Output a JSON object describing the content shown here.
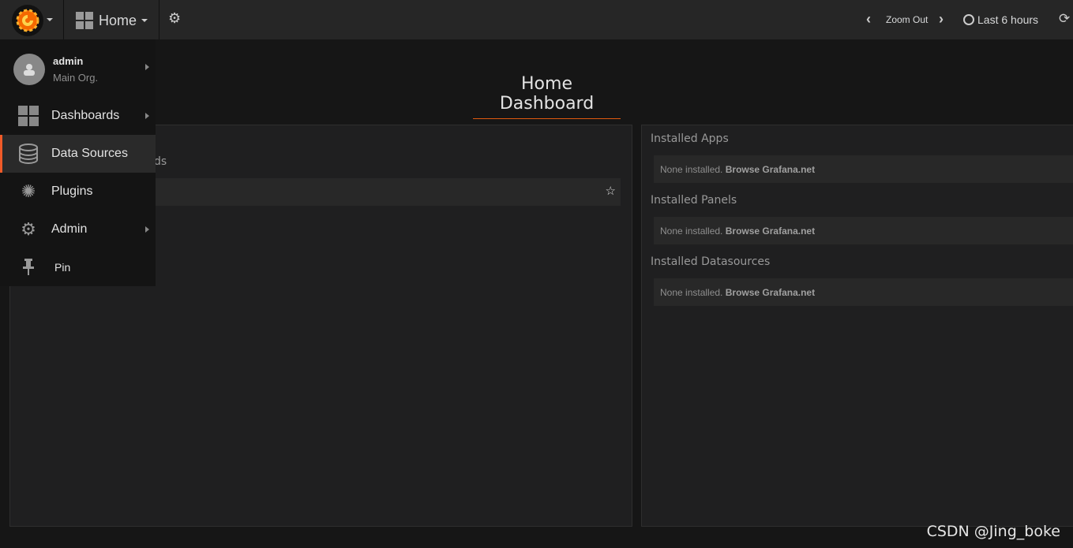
{
  "topbar": {
    "home_label": "Home",
    "zoom_out": "Zoom Out",
    "time_range": "Last 6 hours"
  },
  "page_title": "Home Dashboard",
  "left_panel": {
    "partial_heading": "ds"
  },
  "right_panel": {
    "sections": [
      {
        "title": "Installed Apps",
        "empty": "None installed.",
        "link": "Browse Grafana.net"
      },
      {
        "title": "Installed Panels",
        "empty": "None installed.",
        "link": "Browse Grafana.net"
      },
      {
        "title": "Installed Datasources",
        "empty": "None installed.",
        "link": "Browse Grafana.net"
      }
    ]
  },
  "menu": {
    "user": "admin",
    "org": "Main Org.",
    "items": [
      {
        "label": "Dashboards",
        "icon": "dashboards-grid-icon"
      },
      {
        "label": "Data Sources",
        "icon": "database-icon",
        "active": true
      },
      {
        "label": "Plugins",
        "icon": "plugins-icon"
      },
      {
        "label": "Admin",
        "icon": "gears-icon"
      },
      {
        "label": "Pin",
        "icon": "pin-icon"
      }
    ]
  },
  "colors": {
    "accent": "#f05a28",
    "topbar": "#262626",
    "panel": "#1f1f20"
  },
  "watermark": "CSDN @Jing_boke"
}
